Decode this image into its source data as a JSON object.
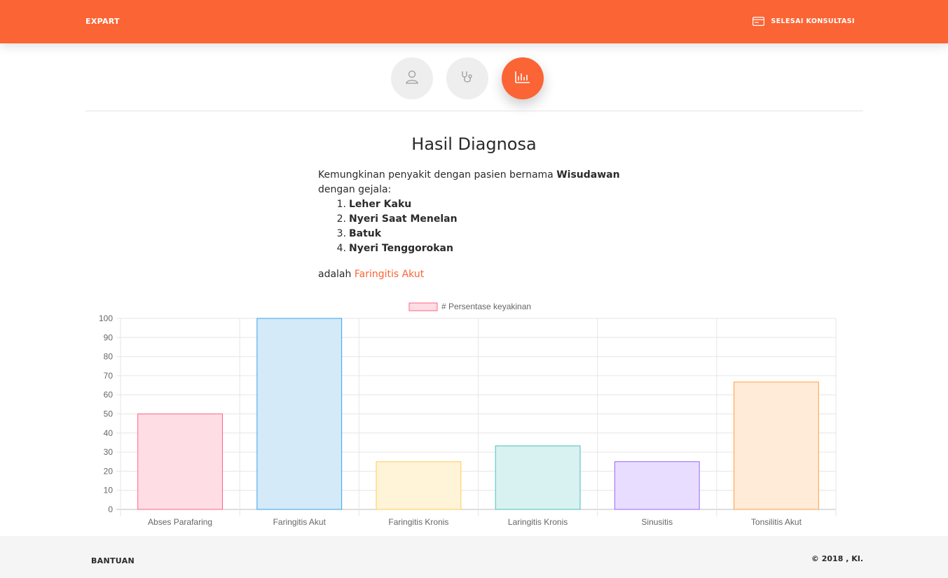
{
  "navbar": {
    "brand": "EXPART",
    "finish_label": "SELESAI KONSULTASI",
    "finish_icon": "card-icon",
    "color": "#fb6434"
  },
  "steps": [
    {
      "icon": "user-icon",
      "active": false
    },
    {
      "icon": "stethoscope-icon",
      "active": false
    },
    {
      "icon": "bar-chart-icon",
      "active": true
    }
  ],
  "main": {
    "title": "Hasil Diagnosa",
    "intro": "Kemungkinan penyakit dengan pasien bernama",
    "patient_name": "Wisudawan",
    "symptoms_label": "dengan gejala:",
    "symptoms": [
      {
        "num": "1.",
        "name": "Leher Kaku"
      },
      {
        "num": "2.",
        "name": "Nyeri Saat Menelan"
      },
      {
        "num": "3.",
        "name": "Batuk"
      },
      {
        "num": "4.",
        "name": "Nyeri Tenggorokan"
      }
    ],
    "conclusion_prefix": "adalah",
    "diagnosis": "Faringitis Akut"
  },
  "chart_data": {
    "type": "bar",
    "legend": "# Persentase keyakinan",
    "legend_position": "top",
    "categories": [
      "Abses Parafaring",
      "Faringitis Akut",
      "Faringitis Kronis",
      "Laringitis Kronis",
      "Sinusitis",
      "Tonsilitis Akut"
    ],
    "series": [
      {
        "name": "# Persentase keyakinan",
        "values": [
          50,
          100,
          25,
          33.3,
          25,
          66.7
        ]
      }
    ],
    "ylim": [
      0,
      100
    ],
    "yticks": [
      0,
      10,
      20,
      30,
      40,
      50,
      60,
      70,
      80,
      90,
      100
    ],
    "grid": true,
    "fill_colors": [
      "#ffdde4",
      "#d4eaf8",
      "#fff3d8",
      "#d8f1f1",
      "#e8ddff",
      "#ffebd7"
    ],
    "border_colors": [
      "#ff6384",
      "#36a2eb",
      "#ffcd56",
      "#4bc0c0",
      "#9966ff",
      "#ff9f40"
    ],
    "legend_fill": "#ffdde4",
    "legend_border": "#ff6384"
  },
  "footer": {
    "help_label": "BANTUAN",
    "copyright": "© 2018 , KI."
  }
}
